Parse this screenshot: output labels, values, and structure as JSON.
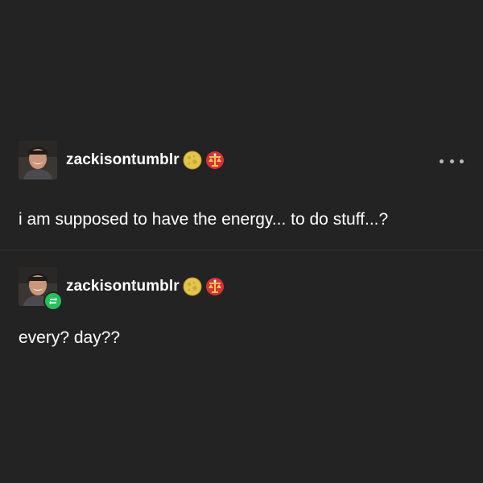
{
  "posts": [
    {
      "username": "zackisontumblr",
      "badges": [
        "moon-badge-icon",
        "libra-scales-badge-icon"
      ],
      "text": "i am supposed to have the energy... to do stuff...?",
      "menu_icon": "more-options-icon"
    },
    {
      "username": "zackisontumblr",
      "badges": [
        "moon-badge-icon",
        "libra-scales-badge-icon"
      ],
      "text": "every? day??",
      "reblog_icon": "reblog-icon"
    }
  ],
  "colors": {
    "background": "#232323",
    "text": "#ffffff",
    "divider": "#363636",
    "reblog_green": "#1fc35a",
    "menu_dots": "#b9b9b9"
  }
}
